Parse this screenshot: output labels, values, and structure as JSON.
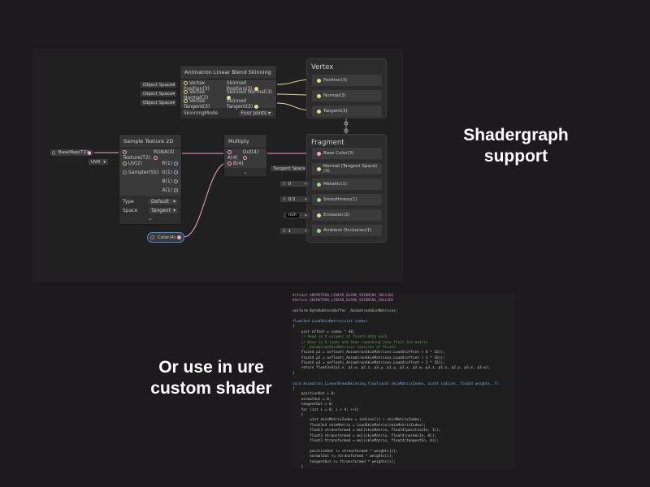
{
  "headings": {
    "shadergraph": "Shadergraph support",
    "custom": "Or use in ure custom shader"
  },
  "skinning_node": {
    "title": "Animatron Linear Blend Skinning",
    "inputs": [
      "Vertex Position(3)",
      "Vertex Normal(3)",
      "Vertex Tangent(3)"
    ],
    "outputs": [
      "Skinned Position(3)",
      "Skinned Normal(3)",
      "Skinned Tangent(3)"
    ],
    "mode_label": "SkinningMode",
    "mode_value": "Four Joints",
    "space_chips": [
      "Object Space",
      "Object Space",
      "Object Space"
    ]
  },
  "sample_node": {
    "title": "Sample Texture 2D",
    "inputs": [
      "Texture(T2)",
      "UV(2)",
      "Sampler(SS)"
    ],
    "outputs": [
      "RGBA(4)",
      "R(1)",
      "G(1)",
      "B(1)",
      "A(1)"
    ],
    "type_label": "Type",
    "type_value": "Default",
    "space_label": "Space",
    "space_value": "Tangent"
  },
  "multiply_node": {
    "title": "Multiply",
    "inputs": [
      "A(4)",
      "B(4)"
    ],
    "output": "Out(4)"
  },
  "property_chips": {
    "basemap": "BaseMap(T2)",
    "uv": "UV0",
    "color": "Color(4)",
    "tangent_space": "Tangent Space",
    "hdr": "HDR"
  },
  "vertex_stack": {
    "title": "Vertex",
    "blocks": [
      "Position(3)",
      "Normal(3)",
      "Tangent(3)"
    ]
  },
  "fragment_stack": {
    "title": "Fragment",
    "blocks": [
      "Base Color(3)",
      "Normal (Tangent Space)(3)",
      "Metallic(1)",
      "Smoothness(1)",
      "Emission(3)",
      "Ambient Occlusion(1)"
    ]
  },
  "fragment_values": [
    {
      "axis": "X",
      "value": "0"
    },
    {
      "axis": "X",
      "value": "0.5"
    },
    {
      "axis": "X",
      "value": "1"
    }
  ],
  "code_lines": [
    "#ifndef ANIMATRON_LINEAR_BLEND_SKINNING_INCLUDE",
    "#define ANIMATRON_LINEAR_BLEND_SKINNING_INCLUDE",
    "",
    "uniform ByteAddressBuffer _AnimatronSkinMatrices;",
    "",
    "float3x4 LoadSkinMatrix(uint index)",
    "{",
    "    uint offset = index * 48;",
    "    // Read in 4 columns of float3 data each.",
    "    // Done in 4 loads and then repacking into final 3x4 matrix",
    "    // _AnimatronSkinMatrices consists of float3",
    "    float4 p1 = asfloat(_AnimatronSkinMatrices.Load4(offset + 0 * 16));",
    "    float4 p2 = asfloat(_AnimatronSkinMatrices.Load4(offset + 1 * 16));",
    "    float4 p3 = asfloat(_AnimatronSkinMatrices.Load4(offset + 2 * 16));",
    "    return float3x4(p1.x, p1.w, p2.z, p3.y, p1.y, p2.x, p2.w, p3.z, p1.z, p2.y, p3.x, p3.w);",
    "}",
    "",
    "void Animatron_LinearBlendSkinning_float(uint skinMatrixIndex, uint4 indices, float4 weights, fl",
    "{",
    "    positionOut = 0;",
    "    normalOut = 0;",
    "    tangentOut = 0;",
    "    for (int i = 0; i < 4; ++i)",
    "    {",
    "        uint skinMatrixIndex = indices[i] + skinMatrixIndex;",
    "        float3x4 skinMatrix = LoadSkinMatrix(skinMatrixIndex);",
    "        float3 vtransformed = mul(skinMatrix, float4(positionIn, 1));",
    "        float3 ntransformed = mul(skinMatrix, float4(normalIn, 0));",
    "        float3 ttransformed = mul(skinMatrix, float4(tangentIn, 0));",
    "",
    "        positionOut += vtransformed * weights[i];",
    "        normalOut += ntransformed * weights[i];",
    "        tangentOut += ttransformed * weights[i];",
    "    }",
    "}"
  ]
}
